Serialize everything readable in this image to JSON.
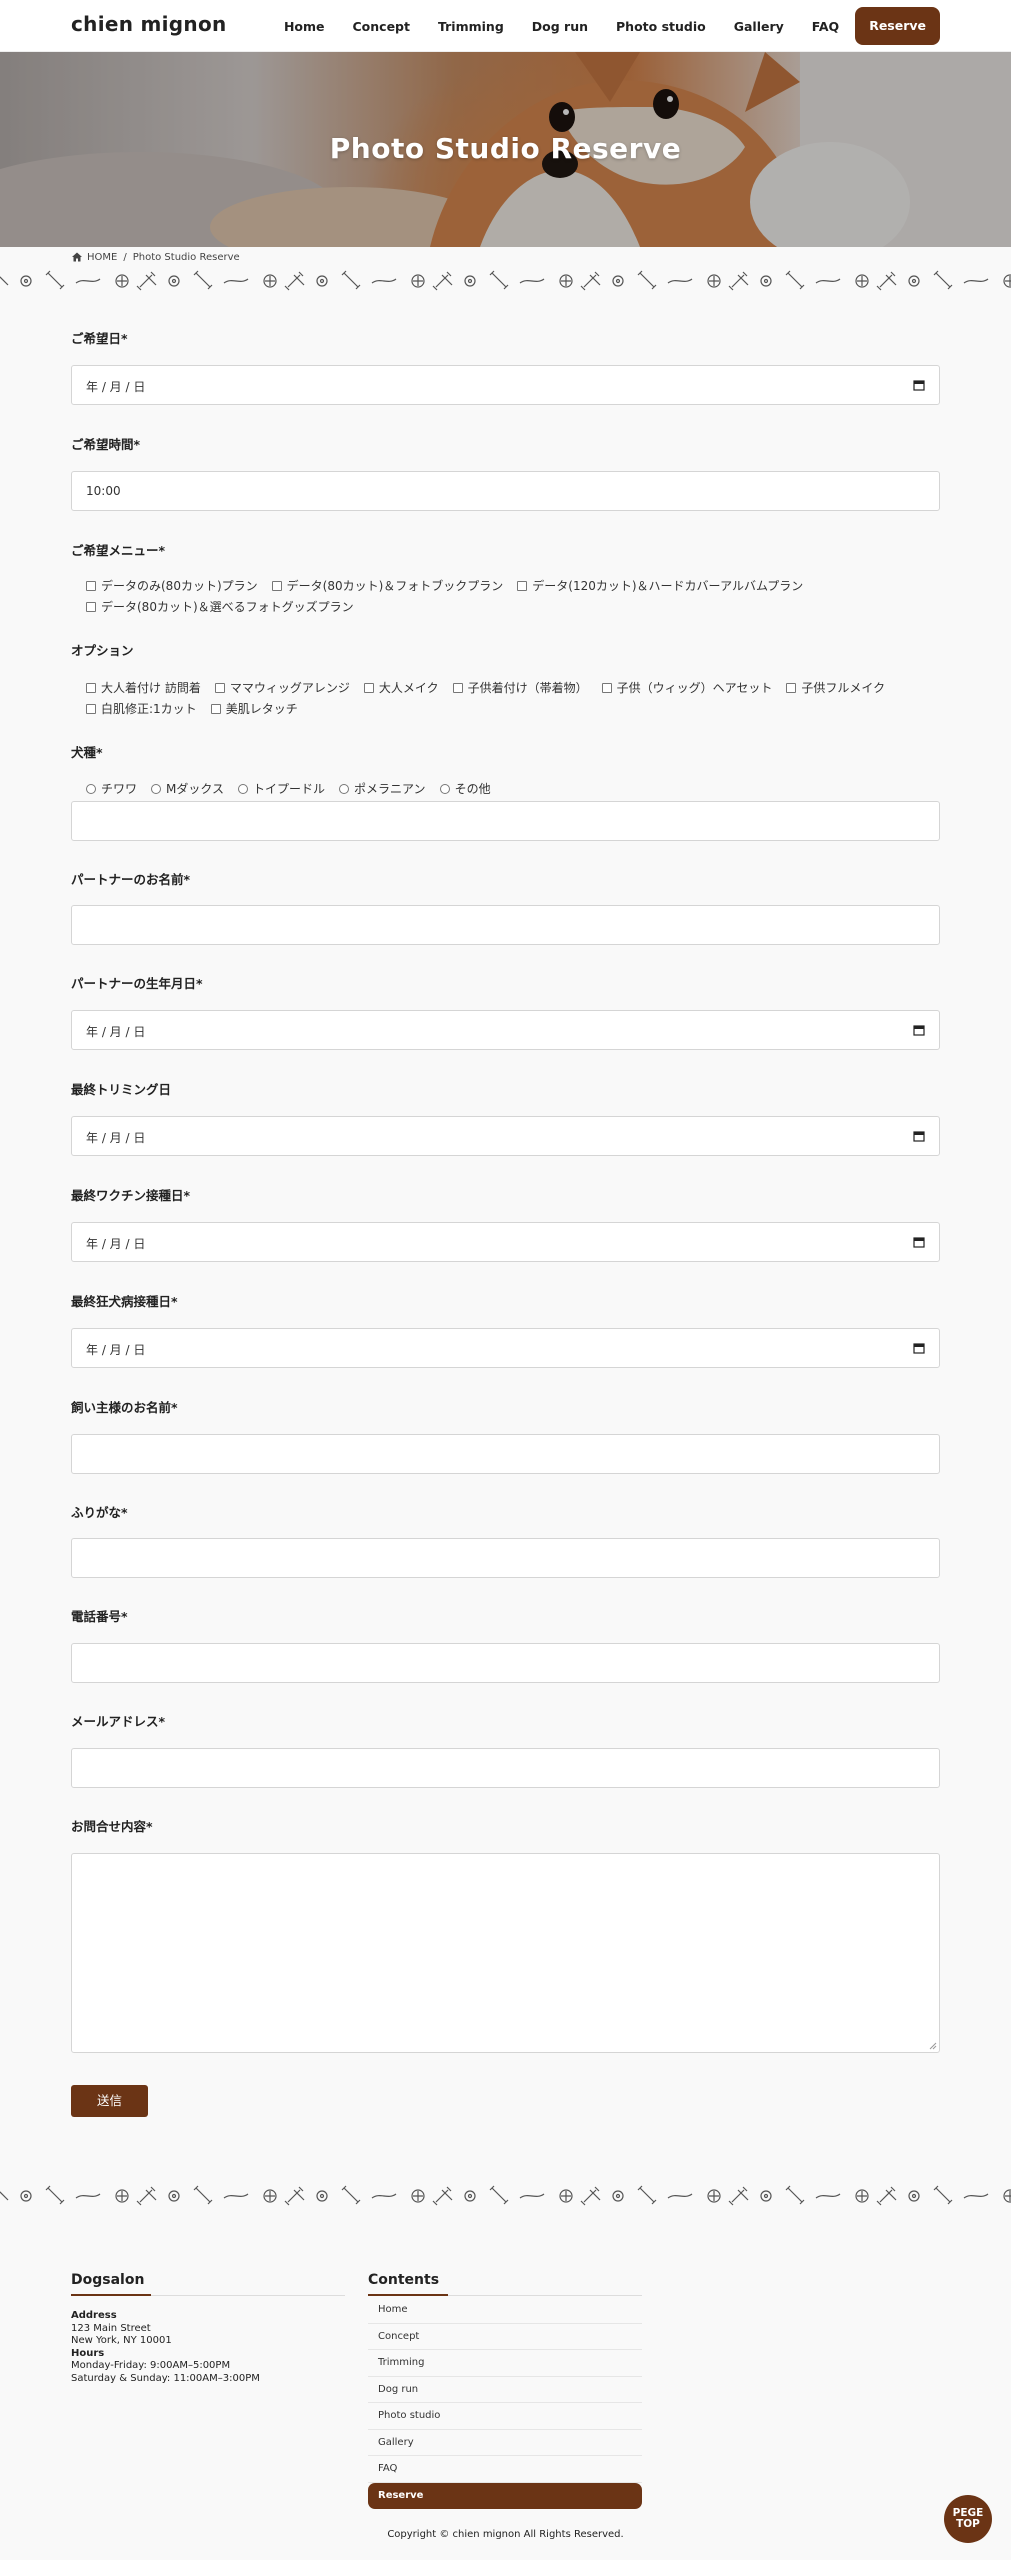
{
  "header": {
    "logo": "chien mignon",
    "nav": [
      "Home",
      "Concept",
      "Trimming",
      "Dog run",
      "Photo studio",
      "Gallery",
      "FAQ"
    ],
    "reserve": "Reserve"
  },
  "hero": {
    "title": "Photo Studio Reserve"
  },
  "breadcrumb": {
    "home": "HOME",
    "separator": "/",
    "current": "Photo Studio Reserve"
  },
  "form": {
    "date_label": "ご希望日*",
    "date_placeholder": "年 / 月 / 日",
    "time_label": "ご希望時間*",
    "time_value": "10:00",
    "menu_label": "ご希望メニュー*",
    "menu_options": [
      "データのみ(80カット)プラン",
      "データ(80カット)＆フォトブックプラン",
      "データ(120カット)＆ハードカバーアルバムプラン",
      "データ(80カット)＆選べるフォトグッズプラン"
    ],
    "option_label": "オプション",
    "option_options": [
      "大人着付け 訪問着",
      "ママウィッグアレンジ",
      "大人メイク",
      "子供着付け（帯着物）",
      "子供（ウィッグ）ヘアセット",
      "子供フルメイク",
      "白肌修正:1カット",
      "美肌レタッチ"
    ],
    "breed_label": "犬種*",
    "breed_options": [
      "チワワ",
      "Mダックス",
      "トイプードル",
      "ポメラニアン",
      "その他"
    ],
    "partner_name_label": "パートナーのお名前*",
    "partner_birth_label": "パートナーの生年月日*",
    "last_trim_label": "最終トリミング日",
    "last_vaccine_label": "最終ワクチン接種日*",
    "last_rabies_label": "最終狂犬病接種日*",
    "owner_name_label": "飼い主様のお名前*",
    "furigana_label": "ふりがな*",
    "phone_label": "電話番号*",
    "email_label": "メールアドレス*",
    "inquiry_label": "お問合せ内容*",
    "submit": "送信"
  },
  "footer": {
    "salon_title": "Dogsalon",
    "address_label": "Address",
    "address_line1": "123 Main Street",
    "address_line2": "New York, NY 10001",
    "hours_label": "Hours",
    "hours_line1": "Monday-Friday: 9:00AM–5:00PM",
    "hours_line2": "Saturday & Sunday: 11:00AM–3:00PM",
    "contents_title": "Contents",
    "links": [
      "Home",
      "Concept",
      "Trimming",
      "Dog run",
      "Photo studio",
      "Gallery",
      "FAQ",
      "Reserve"
    ],
    "copyright": "Copyright © chien mignon All Rights Reserved.",
    "pagetop_line1": "PEGE",
    "pagetop_line2": "TOP"
  },
  "colors": {
    "accent": "#6b3415",
    "background": "#f9f9f9"
  }
}
